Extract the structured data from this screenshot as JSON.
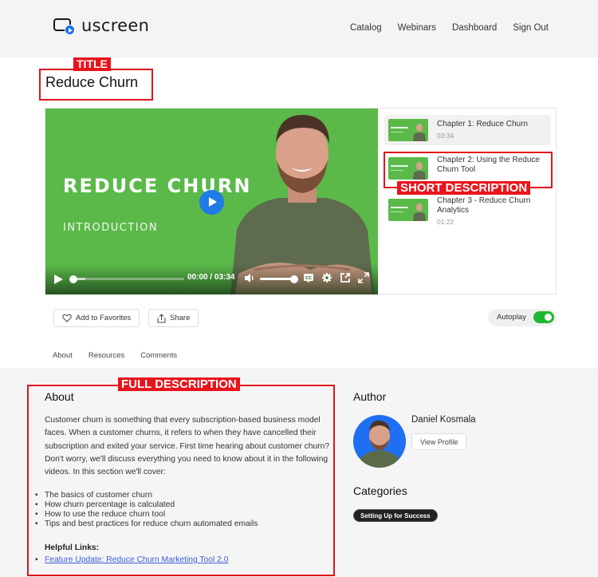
{
  "header": {
    "logo_text": "uscreen",
    "nav": [
      {
        "label": "Catalog"
      },
      {
        "label": "Webinars"
      },
      {
        "label": "Dashboard"
      },
      {
        "label": "Sign Out"
      }
    ]
  },
  "page": {
    "title": "Reduce Churn"
  },
  "video": {
    "overlay_title": "REDUCE CHURN",
    "overlay_subtitle": "INTRODUCTION",
    "current_time": "00:00",
    "separator": "/",
    "duration": "03:34",
    "progress": 0,
    "volume": 1.0
  },
  "chapters": [
    {
      "title": "Chapter 1: Reduce Churn",
      "duration": "03:34",
      "active": true
    },
    {
      "title": "Chapter 2: Using the Reduce Churn Tool",
      "duration": "",
      "active": false
    },
    {
      "title": "Chapter 3 - Reduce Churn Analytics",
      "duration": "01:22",
      "active": false
    }
  ],
  "actions": {
    "favorites_label": "Add to Favorites",
    "share_label": "Share",
    "autoplay_label": "Autoplay",
    "autoplay_on": true
  },
  "tabs": [
    {
      "label": "About",
      "active": true
    },
    {
      "label": "Resources",
      "active": false
    },
    {
      "label": "Comments",
      "active": false
    }
  ],
  "about": {
    "heading": "About",
    "paragraph": "Customer churn is something that every subscription-based business model faces. When a customer churns, it refers to when they have cancelled their subscription and exited your service. First time hearing about customer churn? Don't worry, we'll discuss everything you need to know about it in the following videos. In this section we'll cover:",
    "bullets": [
      "The basics of customer churn",
      "How churn percentage is calculated",
      "How to use the reduce churn tool",
      "Tips and best practices for reduce churn automated emails"
    ],
    "helpful_links_heading": "Helpful Links:",
    "links": [
      {
        "label": "Feature Update: Reduce Churn Marketing Tool 2.0"
      }
    ]
  },
  "author": {
    "heading": "Author",
    "name": "Daniel Kosmala",
    "view_profile_label": "View Profile"
  },
  "categories": {
    "heading": "Categories",
    "items": [
      "Setting Up for Success"
    ]
  },
  "annotations": {
    "title_label": "TITLE",
    "short_description_label": "SHORT DESCRIPTION",
    "full_description_label": "FULL DESCRIPTION",
    "color": "#e0141c"
  }
}
